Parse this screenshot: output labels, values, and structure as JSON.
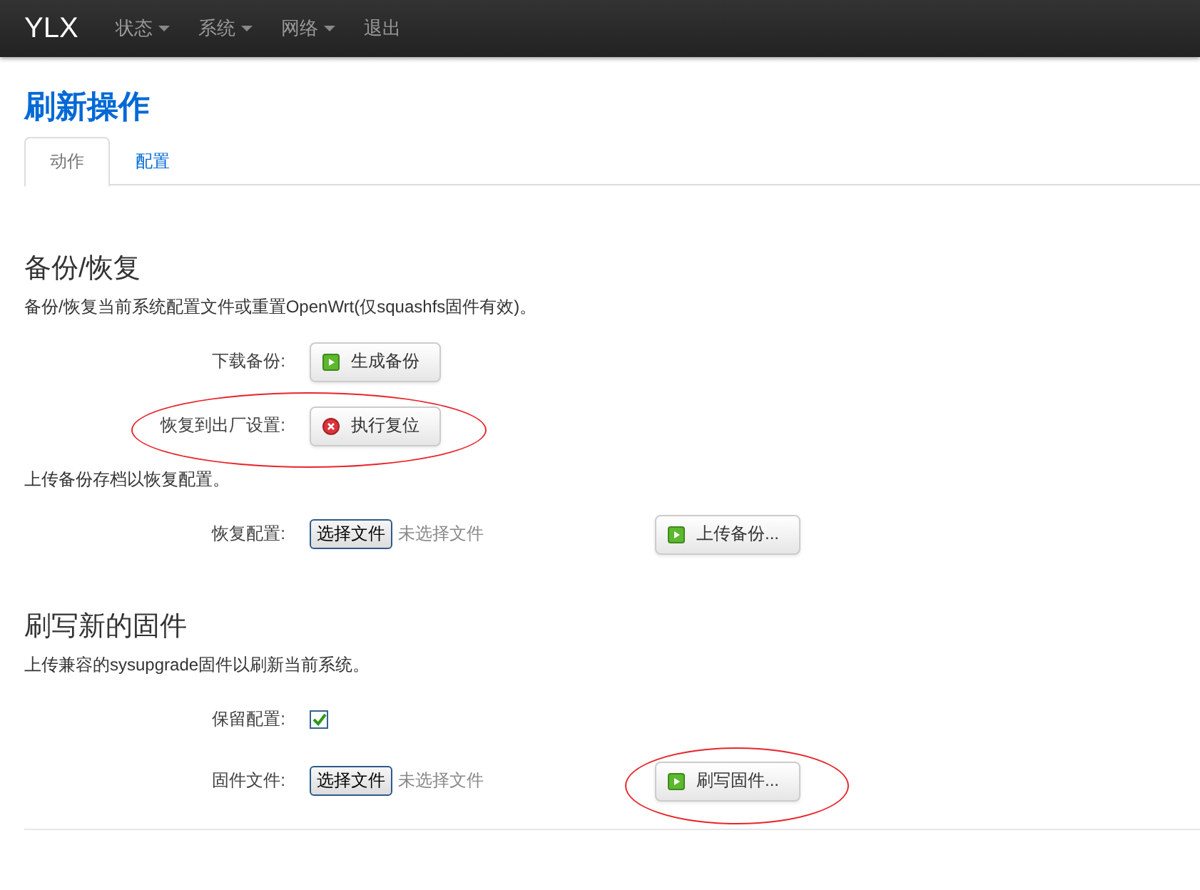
{
  "navbar": {
    "brand": "YLX",
    "menu": [
      {
        "label": "状态",
        "dropdown": true
      },
      {
        "label": "系统",
        "dropdown": true
      },
      {
        "label": "网络",
        "dropdown": true
      },
      {
        "label": "退出",
        "dropdown": false
      }
    ]
  },
  "page_title": "刷新操作",
  "tabs": [
    {
      "label": "动作",
      "selected": true
    },
    {
      "label": "配置",
      "selected": false
    }
  ],
  "sections": [
    {
      "title": "备份/恢复",
      "items": [
        {
          "kind": "text",
          "text": "备份/恢复当前系统配置文件或重置OpenWrt(仅squashfs固件有效)。"
        },
        {
          "kind": "button",
          "label": "下载备份:",
          "circled": false,
          "button": {
            "label": "生成备份",
            "kind": "apply"
          }
        },
        {
          "kind": "button",
          "label": "恢复到出厂设置:",
          "circled": true,
          "button": {
            "label": "执行复位",
            "kind": "reset"
          }
        },
        {
          "kind": "text",
          "text": "上传备份存档以恢复配置。"
        },
        {
          "kind": "file",
          "label": "恢复配置:",
          "choose": "选择文件",
          "status": "未选择文件",
          "action": {
            "label": "上传备份...",
            "kind": "apply",
            "circled": false
          }
        }
      ]
    },
    {
      "title": "刷写新的固件",
      "items": [
        {
          "kind": "text",
          "text": "上传兼容的sysupgrade固件以刷新当前系统。"
        },
        {
          "kind": "checkbox",
          "label": "保留配置:",
          "checked": true
        },
        {
          "kind": "file",
          "label": "固件文件:",
          "choose": "选择文件",
          "status": "未选择文件",
          "action": {
            "label": "刷写固件...",
            "kind": "apply",
            "circled": true
          }
        }
      ]
    }
  ]
}
